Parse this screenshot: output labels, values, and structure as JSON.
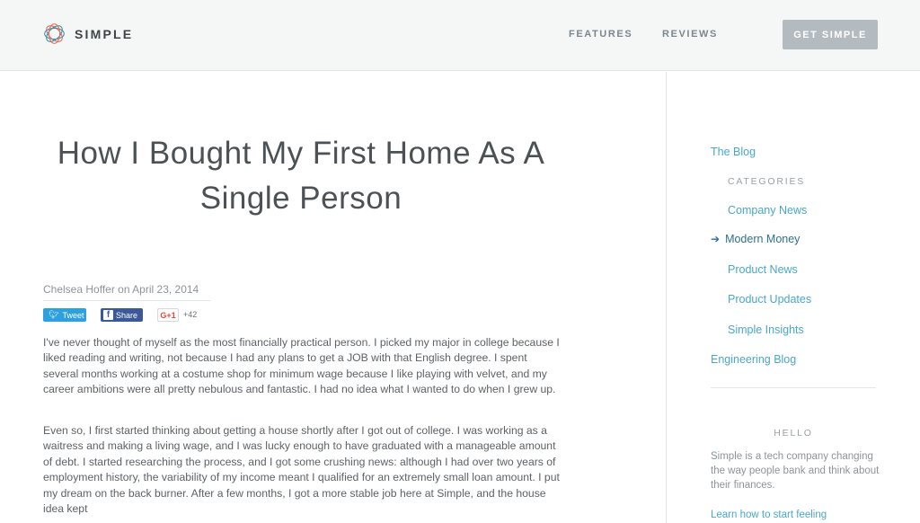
{
  "header": {
    "logo_text": "SIMPLE",
    "nav": [
      "FEATURES",
      "REVIEWS"
    ],
    "cta_label": "GET SIMPLE"
  },
  "article": {
    "title": "How I Bought My First Home As A Single Person",
    "byline": "Chelsea Hoffer on April 23, 2014",
    "share": {
      "tweet_label": "Tweet",
      "facebook_label": "Share",
      "gplus_label": "G+1",
      "gplus_count": "+42"
    },
    "paragraphs": [
      "I've never thought of myself as the most financially practical person. I picked my major in college because I liked reading and writing, not because I had any plans to get a JOB with that English degree. I spent several months working at a costume shop for minimum wage because I like playing with velvet, and my career ambitions were all pretty nebulous and fantastic. I had no idea what I wanted to do when I grew up.",
      "Even so, I first started thinking about getting a house shortly after I got out of college. I was working as a waitress and making a living wage, and I was lucky enough to have graduated with a manageable amount of debt. I started researching the process, and I got some crushing news: although I had over two years of employment history, the variability of my income meant I qualified for an extremely small loan amount. I put my dream on the back burner. After a few months, I got a more stable job here at Simple, and the house idea kept"
    ]
  },
  "sidebar": {
    "blog_link": "The Blog",
    "categories_heading": "CATEGORIES",
    "categories": [
      {
        "label": "Company News",
        "active": false
      },
      {
        "label": "Modern Money",
        "active": true
      },
      {
        "label": "Product News",
        "active": false
      },
      {
        "label": "Product Updates",
        "active": false
      },
      {
        "label": "Simple Insights",
        "active": false
      }
    ],
    "engineering_link": "Engineering Blog",
    "hello_heading": "HELLO",
    "hello_text": "Simple is a tech company changing the way people bank and think about their finances.",
    "learn_link": "Learn how to start feeling"
  },
  "colors": {
    "link": "#4aa7cb",
    "active_link": "#2f6f8f",
    "cta_bg": "#b4bbc0",
    "tweet_bg": "#2ea0dd",
    "facebook_bg": "#3b5999"
  }
}
